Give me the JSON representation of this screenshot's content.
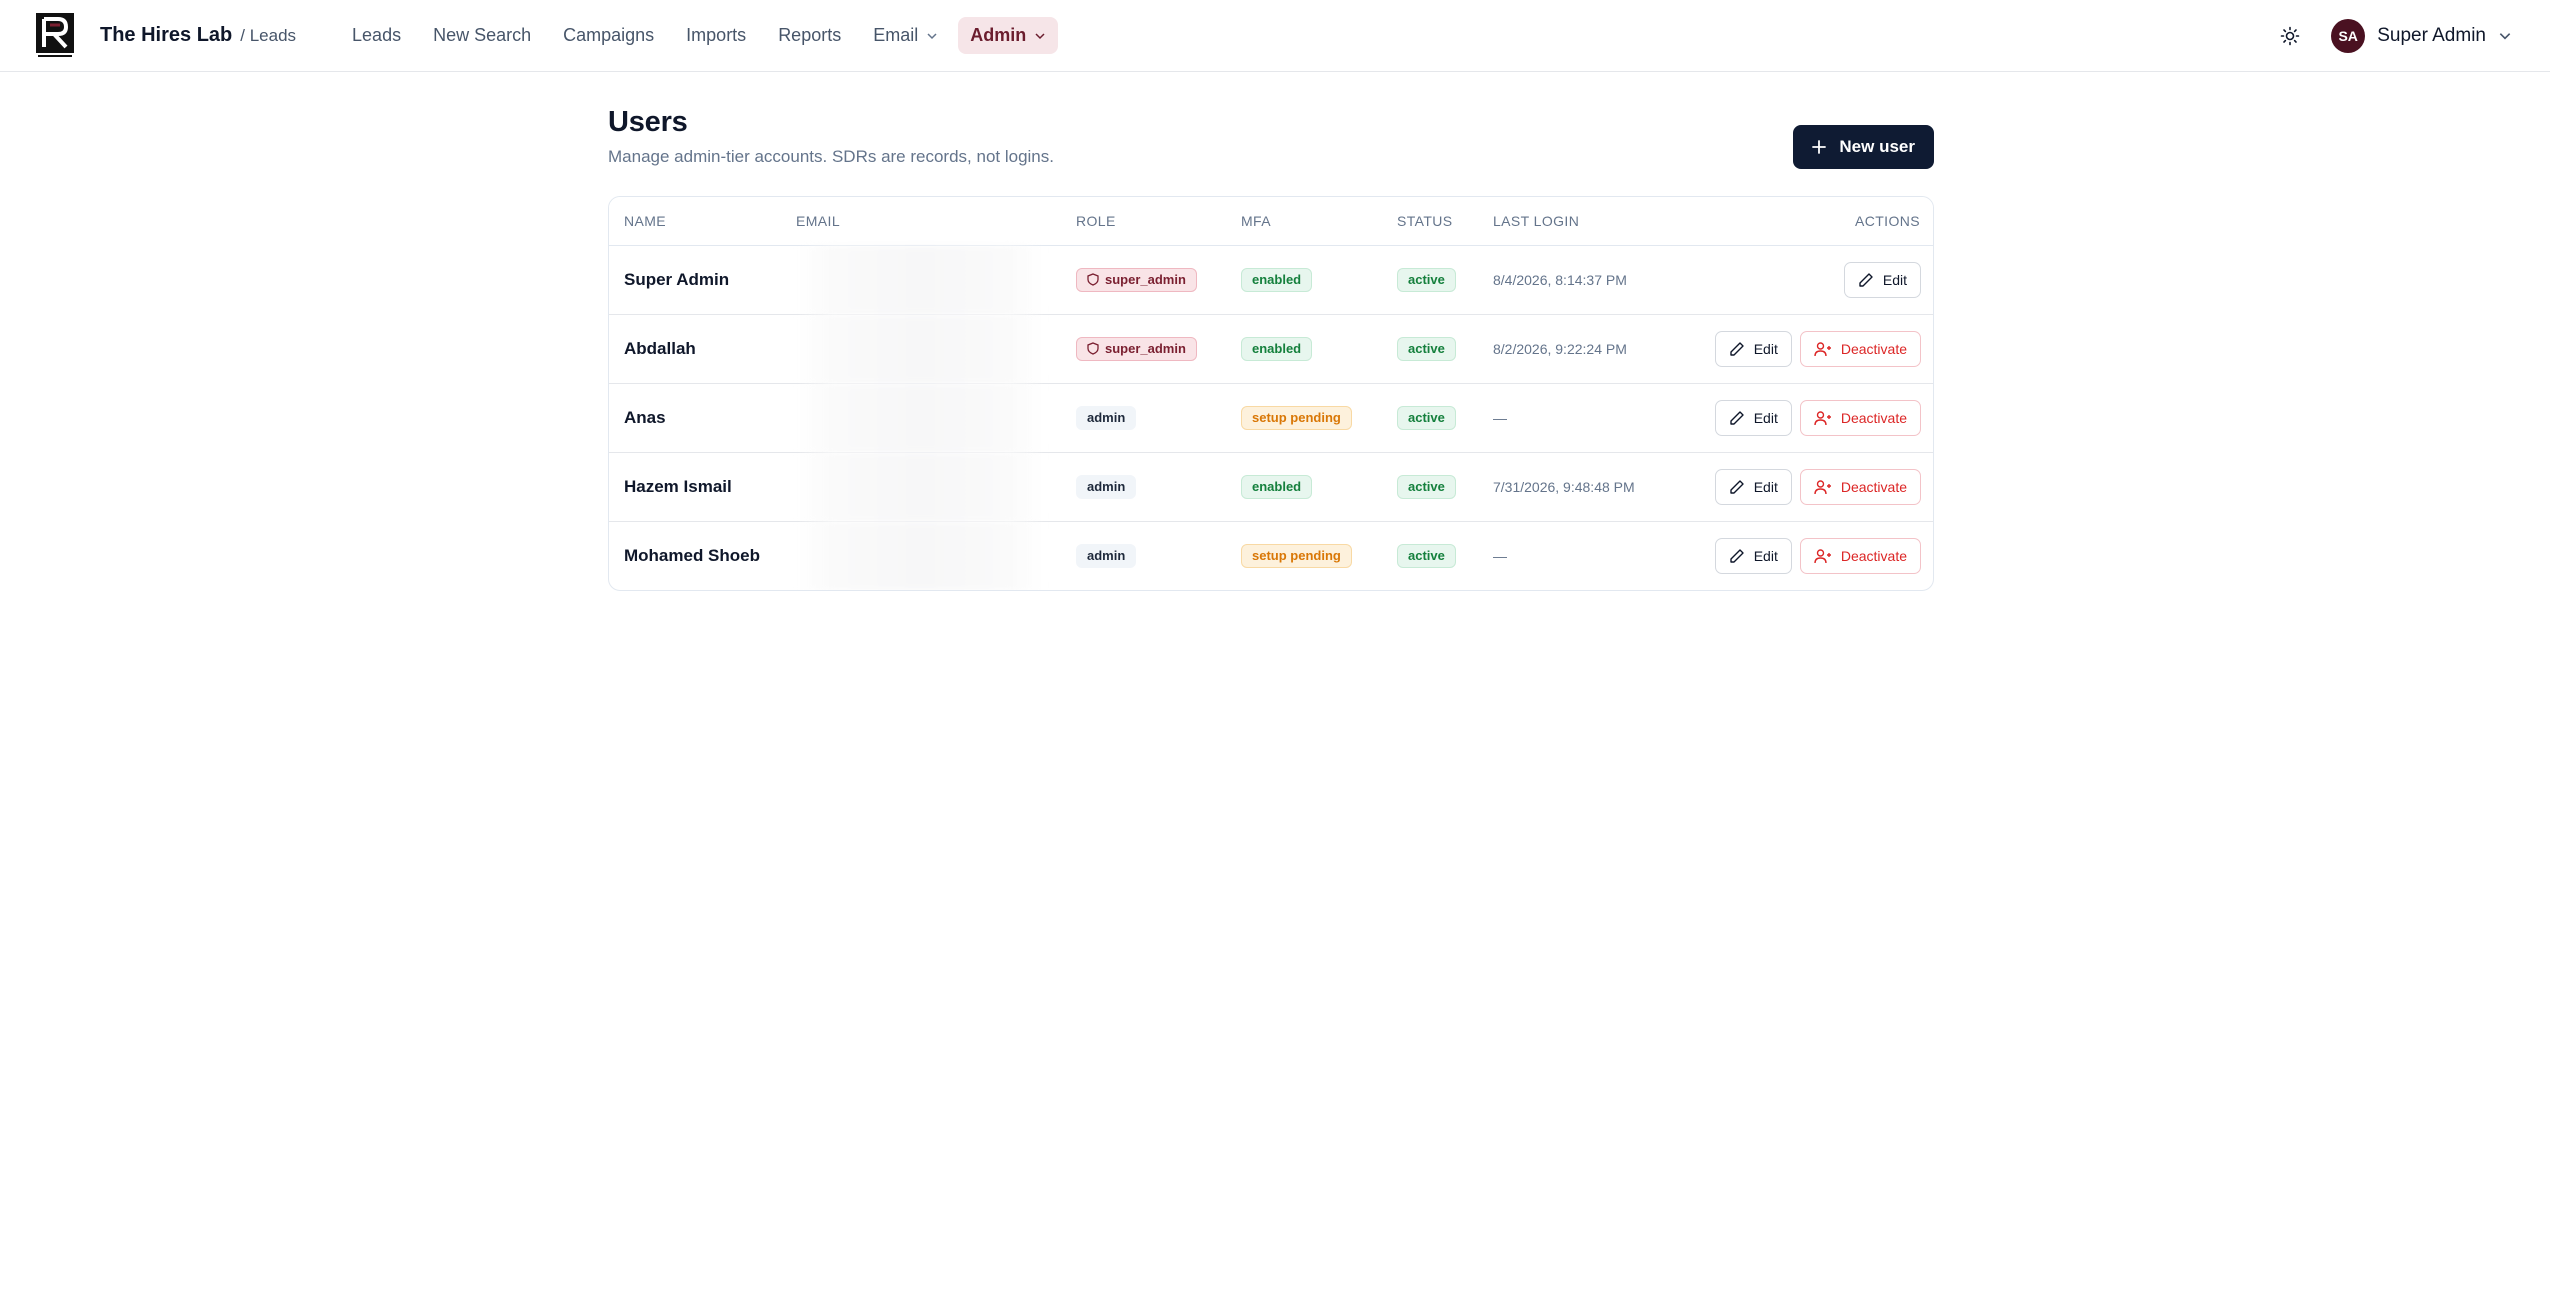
{
  "header": {
    "brand": "The Hires Lab",
    "brand_sub": "/ Leads",
    "nav": [
      {
        "label": "Leads"
      },
      {
        "label": "New Search"
      },
      {
        "label": "Campaigns"
      },
      {
        "label": "Imports"
      },
      {
        "label": "Reports"
      },
      {
        "label": "Email",
        "dropdown": true
      },
      {
        "label": "Admin",
        "dropdown": true,
        "active": true
      }
    ],
    "user": {
      "initials": "SA",
      "name": "Super Admin"
    }
  },
  "page": {
    "title": "Users",
    "subtitle": "Manage admin-tier accounts. SDRs are records, not logins.",
    "new_user_label": "New user"
  },
  "table": {
    "columns": [
      "NAME",
      "EMAIL",
      "ROLE",
      "MFA",
      "STATUS",
      "LAST LOGIN",
      "ACTIONS"
    ],
    "rows": [
      {
        "name": "Super Admin",
        "role": "super_admin",
        "mfa": "enabled",
        "status": "active",
        "last_login": "8/4/2026, 8:14:37 PM",
        "edit": "Edit",
        "deactivate": null
      },
      {
        "name": "Abdallah",
        "role": "super_admin",
        "mfa": "enabled",
        "status": "active",
        "last_login": "8/2/2026, 9:22:24 PM",
        "edit": "Edit",
        "deactivate": "Deactivate"
      },
      {
        "name": "Anas",
        "role": "admin",
        "mfa": "setup pending",
        "status": "active",
        "last_login": "—",
        "edit": "Edit",
        "deactivate": "Deactivate"
      },
      {
        "name": "Hazem Ismail",
        "role": "admin",
        "mfa": "enabled",
        "status": "active",
        "last_login": "7/31/2026, 9:48:48 PM",
        "edit": "Edit",
        "deactivate": "Deactivate"
      },
      {
        "name": "Mohamed Shoeb",
        "role": "admin",
        "mfa": "setup pending",
        "status": "active",
        "last_login": "—",
        "edit": "Edit",
        "deactivate": "Deactivate"
      }
    ]
  },
  "colors": {
    "brand": "#4a1121",
    "primary_button": "#0f1b33",
    "admin_active_bg": "#f6e5e8",
    "danger": "#dc2626",
    "success": "#15803d",
    "warning": "#d97706"
  },
  "icons": {
    "logo": "hires-lab-logo",
    "theme": "sun-icon",
    "dropdown": "chevron-down-icon",
    "new_user": "plus-icon",
    "role_super": "shield-icon",
    "edit": "pencil-icon",
    "deactivate": "user-minus-icon"
  }
}
